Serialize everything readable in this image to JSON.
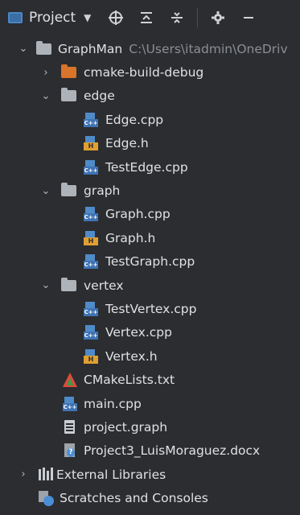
{
  "toolbar": {
    "title": "Project",
    "caret": "▼",
    "icons": [
      "crosshair-icon",
      "collapse-all-icon",
      "expand-all-icon",
      "gear-icon",
      "minimize-icon"
    ]
  },
  "tree": {
    "root": {
      "label": "GraphMan",
      "path": "C:\\Users\\itadmin\\OneDriv"
    },
    "cmake_build": "cmake-build-debug",
    "edge": {
      "label": "edge",
      "files": [
        "Edge.cpp",
        "Edge.h",
        "TestEdge.cpp"
      ]
    },
    "graph": {
      "label": "graph",
      "files": [
        "Graph.cpp",
        "Graph.h",
        "TestGraph.cpp"
      ]
    },
    "vertex": {
      "label": "vertex",
      "files": [
        "TestVertex.cpp",
        "Vertex.cpp",
        "Vertex.h"
      ]
    },
    "root_files": [
      "CMakeLists.txt",
      "main.cpp",
      "project.graph",
      "Project3_LuisMoraguez.docx"
    ],
    "external_libraries": "External Libraries",
    "scratches": "Scratches and Consoles"
  },
  "icons": {
    "cpp_badge": "C++",
    "h_badge": "H",
    "docx_badge": "?"
  },
  "colors": {
    "background": "#2b2d30",
    "folder": "#aeb3ba",
    "excluded_folder": "#d9742b",
    "cpp_icon": "#3f73b4",
    "header_icon": "#e0a031",
    "dim_text": "#8b8e94"
  }
}
